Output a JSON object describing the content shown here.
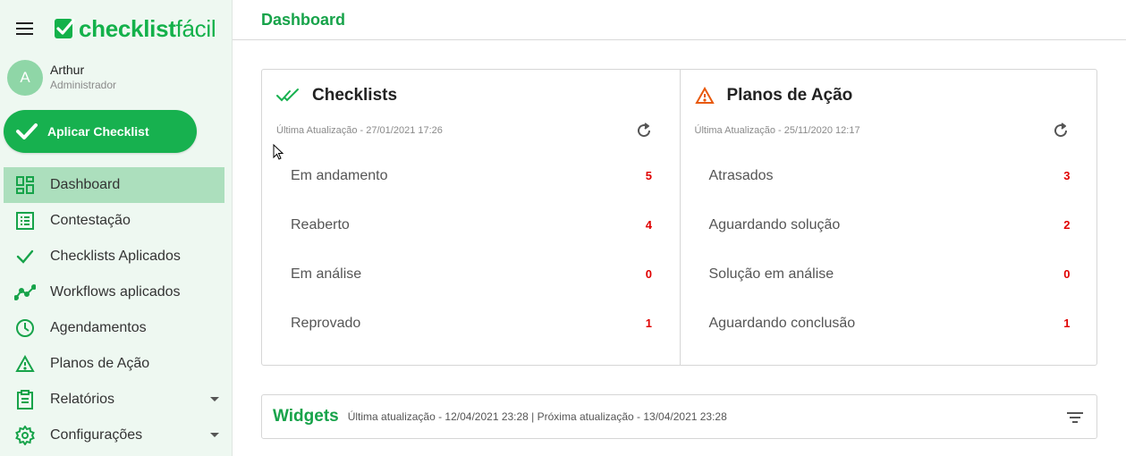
{
  "brand": {
    "name_bold": "checklist",
    "name_light": "fácil",
    "color": "#13b14a"
  },
  "user": {
    "initial": "A",
    "name": "Arthur",
    "role": "Administrador"
  },
  "apply_button": {
    "label": "Aplicar Checklist"
  },
  "sidebar": {
    "items": [
      {
        "label": "Dashboard",
        "icon": "dashboard-icon",
        "active": true
      },
      {
        "label": "Contestação",
        "icon": "list-icon"
      },
      {
        "label": "Checklists Aplicados",
        "icon": "check-icon"
      },
      {
        "label": "Workflows aplicados",
        "icon": "trend-icon"
      },
      {
        "label": "Agendamentos",
        "icon": "clock-icon"
      },
      {
        "label": "Planos de Ação",
        "icon": "warning-icon"
      },
      {
        "label": "Relatórios",
        "icon": "clipboard-icon",
        "has_submenu": true
      },
      {
        "label": "Configurações",
        "icon": "gear-icon",
        "has_submenu": true
      }
    ]
  },
  "header": {
    "title": "Dashboard"
  },
  "checklists": {
    "title": "Checklists",
    "updated": "Última Atualização - 27/01/2021 17:26",
    "rows": [
      {
        "label": "Em andamento",
        "count": "5"
      },
      {
        "label": "Reaberto",
        "count": "4"
      },
      {
        "label": "Em análise",
        "count": "0"
      },
      {
        "label": "Reprovado",
        "count": "1"
      }
    ]
  },
  "action_plans": {
    "title": "Planos de Ação",
    "updated": "Última Atualização - 25/11/2020 12:17",
    "rows": [
      {
        "label": "Atrasados",
        "count": "3"
      },
      {
        "label": "Aguardando solução",
        "count": "2"
      },
      {
        "label": "Solução em análise",
        "count": "0"
      },
      {
        "label": "Aguardando conclusão",
        "count": "1"
      }
    ]
  },
  "widgets": {
    "title": "Widgets",
    "info": "Última atualização - 12/04/2021 23:28 | Próxima atualização - 13/04/2021 23:28"
  },
  "colors": {
    "accent": "#17b14f",
    "active_bg": "#acdfbd",
    "count": "#e00000",
    "warning": "#e8590c"
  }
}
